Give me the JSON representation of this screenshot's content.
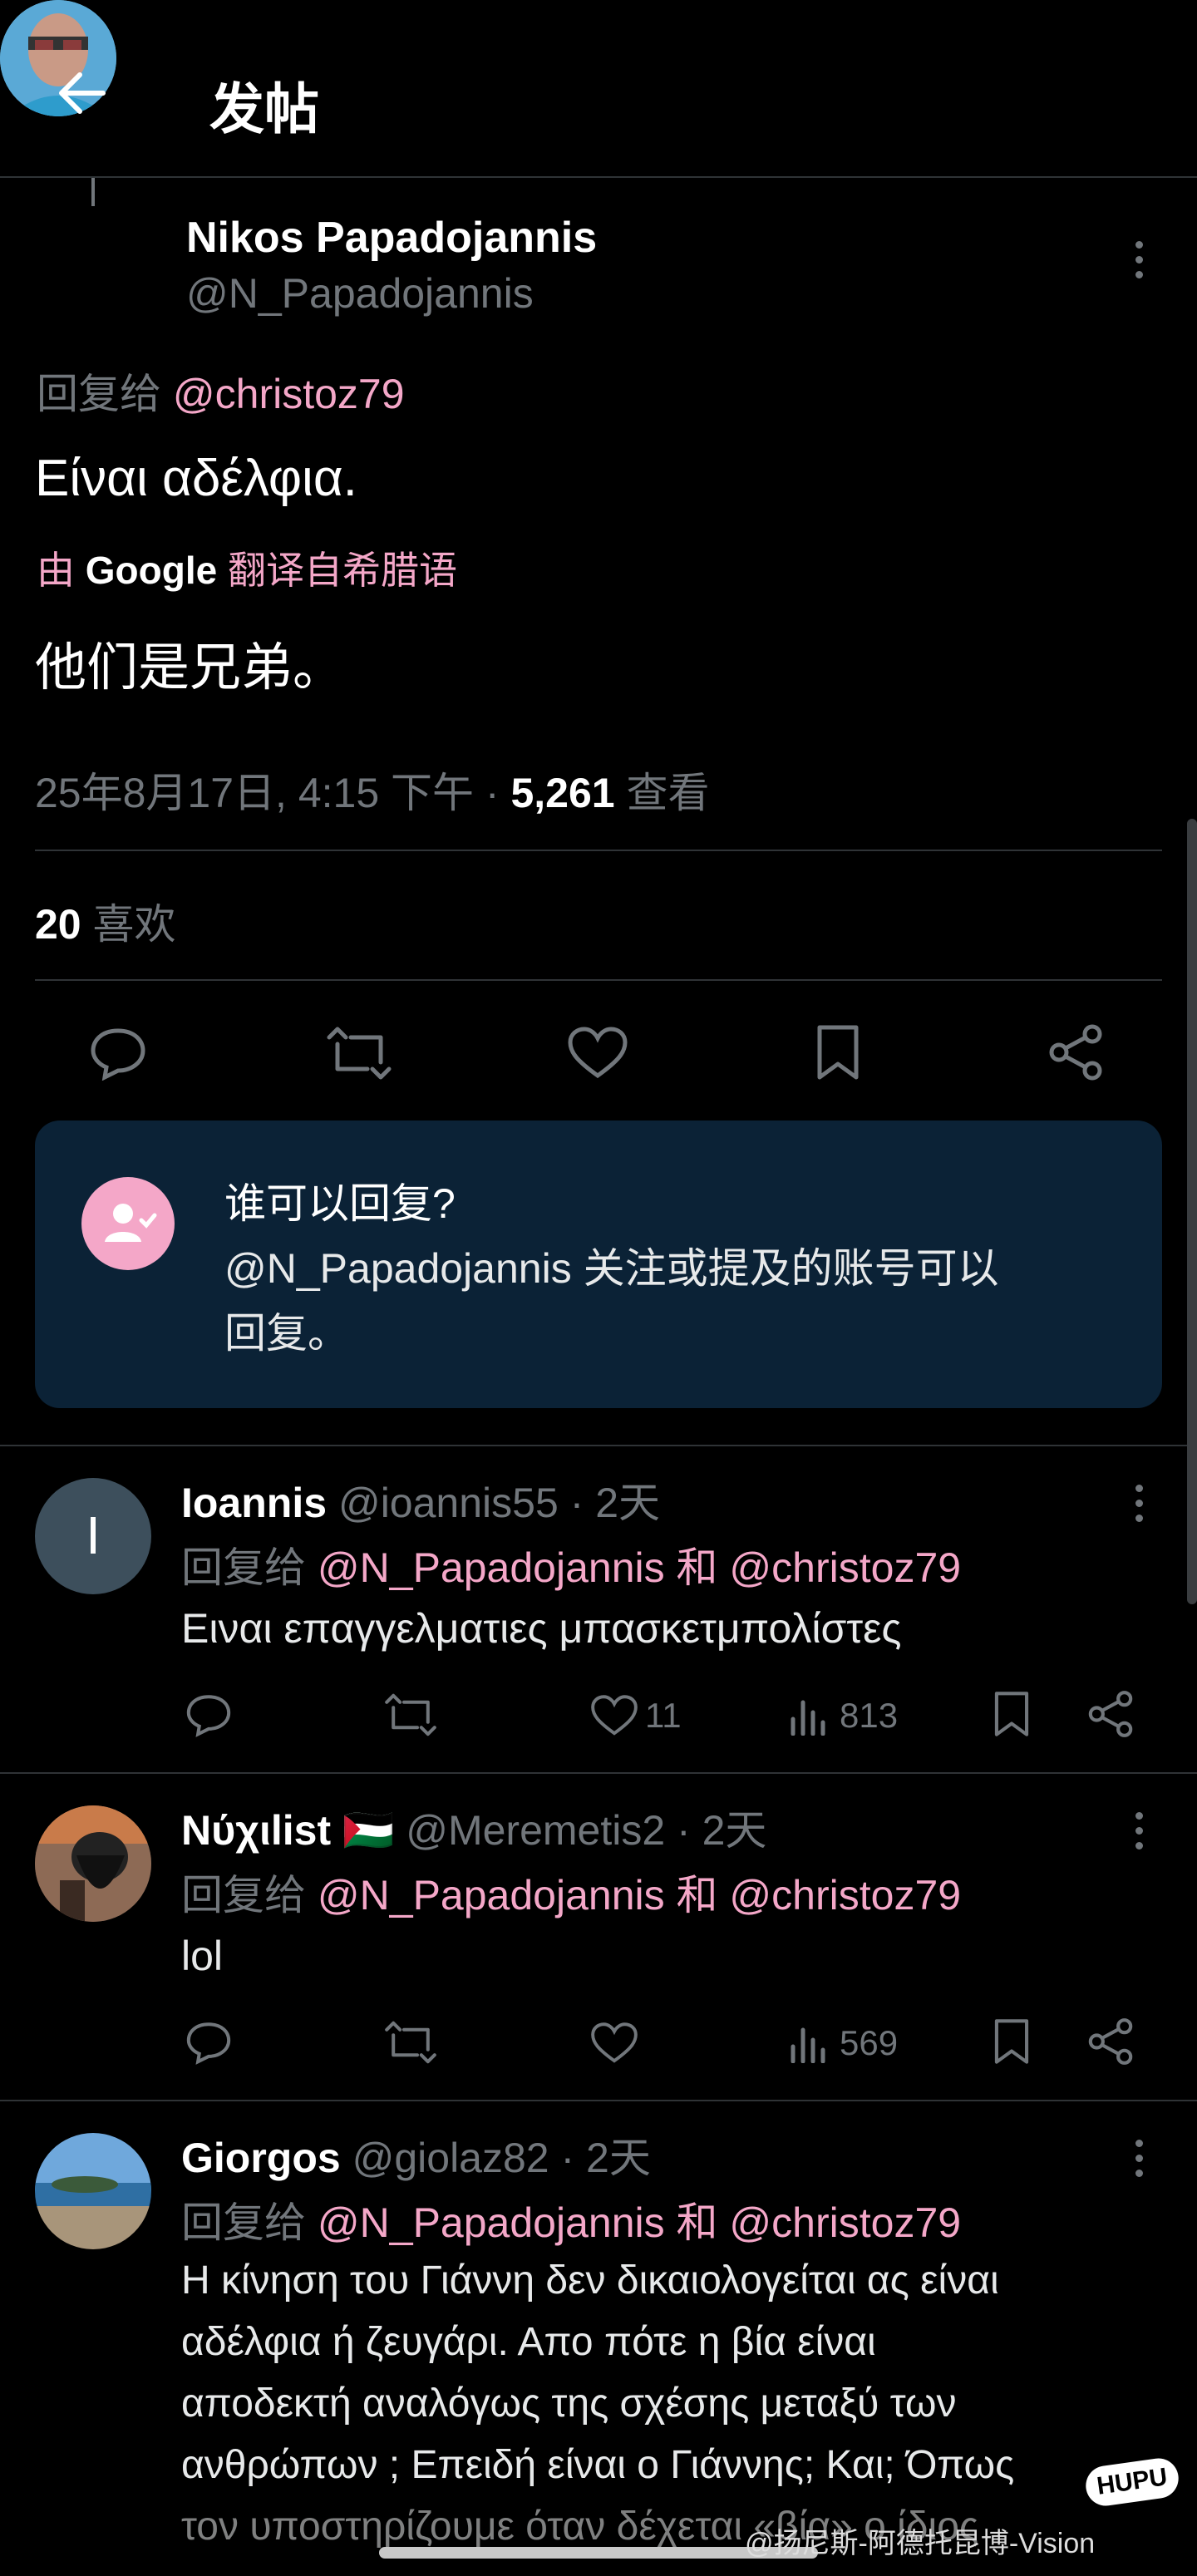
{
  "header": {
    "title": "发帖"
  },
  "tweet": {
    "author_name": "Nikos Papadojannis",
    "author_handle": "@N_Papadojannis",
    "reply_prefix": "回复给",
    "reply_to": "@christoz79",
    "text": "Είναι αδέλφια.",
    "translate_by": "由",
    "translate_brand": "Google",
    "translate_suffix": "翻译自希腊语",
    "translation": "他们是兄弟。",
    "timestamp": "25年8月17日, 4:15 下午 · ",
    "views_count": "5,261",
    "views_label": " 查看",
    "likes_count": "20",
    "likes_label": " 喜欢"
  },
  "who_can_reply": {
    "title": "谁可以回复?",
    "line1": "@N_Papadojannis 关注或提及的账号可以",
    "line2": "回复。"
  },
  "replies": [
    {
      "name": "Ioannis",
      "handle": "@ioannis55 · 2天",
      "reply_prefix": "回复给",
      "mention1": "@N_Papadojannis",
      "conj": "和",
      "mention2": "@christoz79",
      "text": "Ειναι επαγγελματιες μπασκετμπολίστες",
      "likes": "11",
      "views": "813",
      "avatar_letter": "I"
    },
    {
      "name": "Νύχιlist",
      "flag": "🇵🇸",
      "handle": "@Meremetis2 · 2天",
      "reply_prefix": "回复给",
      "mention1": "@N_Papadojannis",
      "conj": "和",
      "mention2": "@christoz79",
      "text": "lol",
      "likes": "",
      "views": "569"
    },
    {
      "name": "Giorgos",
      "handle": "@giolaz82 · 2天",
      "reply_prefix": "回复给",
      "mention1": "@N_Papadojannis",
      "conj": "和",
      "mention2": "@christoz79",
      "text_lines": [
        "Η κίνηση του Γιάννη δεν δικαιολογείται ας είναι",
        "αδέλφια ή ζευγάρι. Απο πότε η βία είναι",
        "αποδεκτή αναλόγως της σχέσης μεταξύ των",
        "ανθρώπων ; Επειδή είναι ο Γιάννης; Και; Όπως",
        "τον υποστηρίζουμε όταν δέχεται «βία» ο ίδιος"
      ]
    }
  ],
  "watermark": {
    "text": "@扬尼斯-阿德托昆博-Vision",
    "logo": "HUPU"
  },
  "colors": {
    "background": "#000000",
    "accent_pink": "#f4a7c8",
    "muted": "#71767b",
    "card": "#0b2236"
  }
}
